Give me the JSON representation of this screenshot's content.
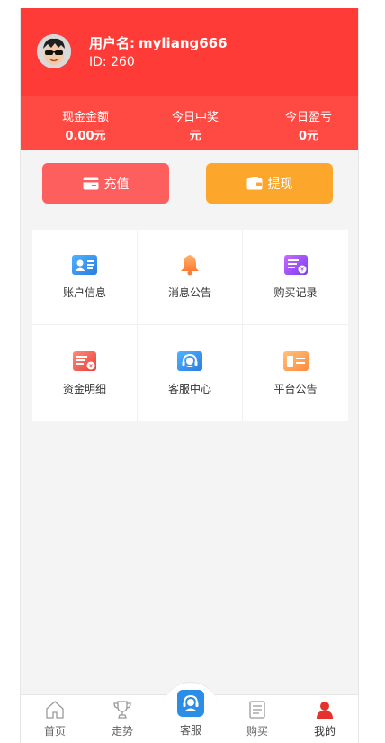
{
  "user": {
    "name_label": "用户名:",
    "name": "myliang666",
    "id_text": "ID: 260"
  },
  "stats": [
    {
      "label": "现金金额",
      "value": "0.00元"
    },
    {
      "label": "今日中奖",
      "value": "元"
    },
    {
      "label": "今日盈亏",
      "value": "0元"
    }
  ],
  "actions": {
    "recharge": "充值",
    "withdraw": "提现"
  },
  "menu": [
    {
      "label": "账户信息",
      "icon": "account-card-icon"
    },
    {
      "label": "消息公告",
      "icon": "bell-icon"
    },
    {
      "label": "购买记录",
      "icon": "purchase-record-icon"
    },
    {
      "label": "资金明细",
      "icon": "fund-detail-icon"
    },
    {
      "label": "客服中心",
      "icon": "customer-service-icon"
    },
    {
      "label": "平台公告",
      "icon": "platform-notice-icon"
    }
  ],
  "tabbar": [
    {
      "label": "首页",
      "icon": "home-icon"
    },
    {
      "label": "走势",
      "icon": "trophy-icon"
    },
    {
      "label": "客服",
      "icon": "customer-service-icon"
    },
    {
      "label": "购买",
      "icon": "document-icon"
    },
    {
      "label": "我的",
      "icon": "user-icon"
    }
  ],
  "colors": {
    "header": "#fe3b36",
    "stats_bar": "#ff4a44",
    "recharge": "#fd5e5e",
    "withdraw": "#fca72c",
    "active_tab": "#e5322d"
  }
}
